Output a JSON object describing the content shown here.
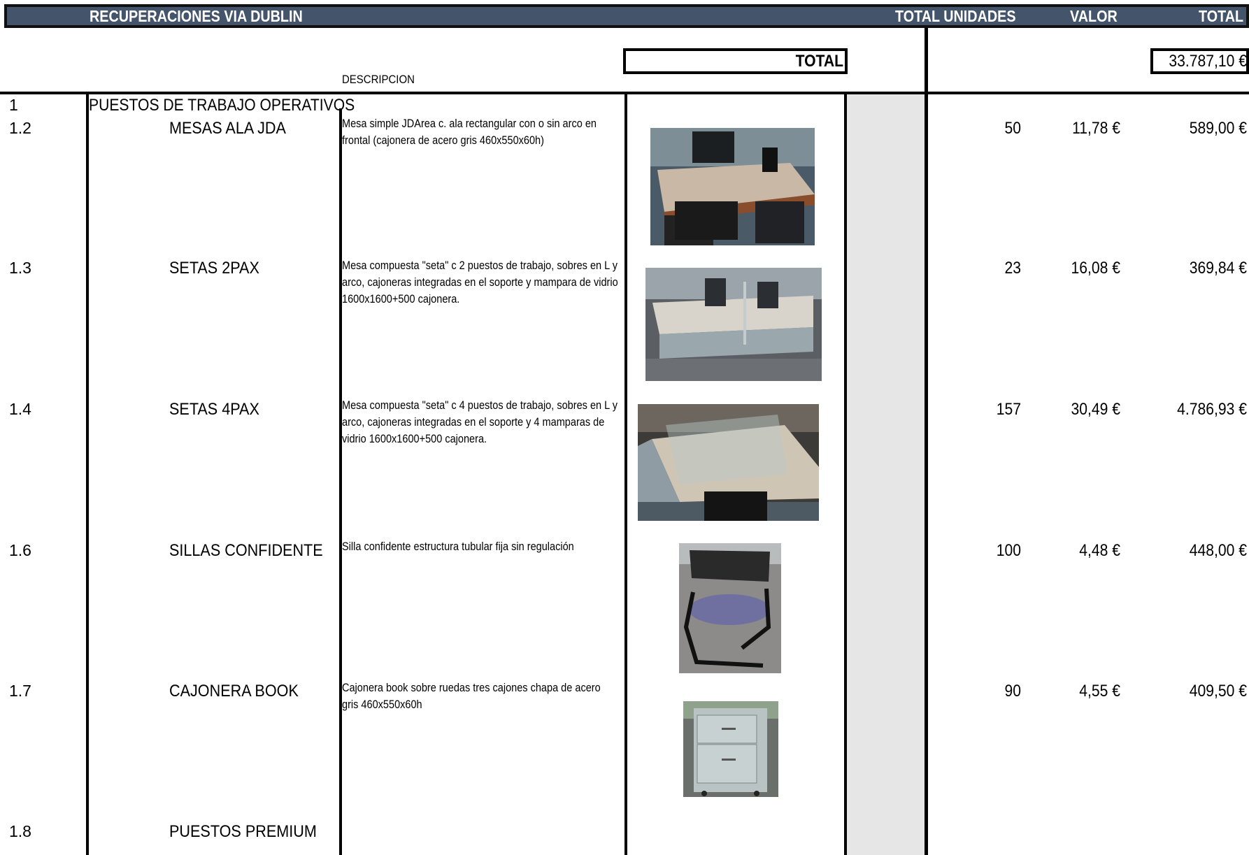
{
  "header": {
    "title": "RECUPERACIONES VIA DUBLIN",
    "col_units": "TOTAL UNIDADES",
    "col_value": "VALOR",
    "col_total": "TOTAL"
  },
  "summary": {
    "total_label": "TOTAL",
    "total_value": "33.787,10 €",
    "description_header": "DESCRIPCION"
  },
  "section": {
    "code": "1",
    "title": "PUESTOS DE TRABAJO OPERATIVOS"
  },
  "rows": [
    {
      "code": "1.2",
      "name": "MESAS ALA JDA",
      "description": "Mesa simple JDArea c. ala rectangular con o sin arco en frontal (cajonera de acero gris 460x550x60h)",
      "units": "50",
      "value": "11,78 €",
      "total": "589,00 €",
      "photo_icon": "office-desk-photo"
    },
    {
      "code": "1.3",
      "name": "SETAS 2PAX",
      "description": "Mesa compuesta \"seta\" c 2 puestos de trabajo, sobres en L y arco, cajoneras integradas en el soporte y mampara de vidrio 1600x1600+500 cajonera.",
      "units": "23",
      "value": "16,08 €",
      "total": "369,84 €",
      "photo_icon": "workstation-2pax-photo"
    },
    {
      "code": "1.4",
      "name": "SETAS 4PAX",
      "description": "Mesa compuesta \"seta\" c 4 puestos de trabajo, sobres en L y arco, cajoneras integradas en el soporte y 4 mamparas de vidrio 1600x1600+500 cajonera.",
      "units": "157",
      "value": "30,49 €",
      "total": "4.786,93 €",
      "photo_icon": "workstation-4pax-photo"
    },
    {
      "code": "1.6",
      "name": "SILLAS CONFIDENTE",
      "description": "Silla confidente estructura tubular fija sin regulación",
      "units": "100",
      "value": "4,48 €",
      "total": "448,00 €",
      "photo_icon": "chair-photo"
    },
    {
      "code": "1.7",
      "name": "CAJONERA BOOK",
      "description": "Cajonera book sobre ruedas tres cajones chapa de acero gris 460x550x60h",
      "units": "90",
      "value": "4,55 €",
      "total": "409,50 €",
      "photo_icon": "drawer-cabinet-photo"
    },
    {
      "code": "1.8",
      "name": "PUESTOS PREMIUM",
      "description": "",
      "units": "",
      "value": "",
      "total": ""
    }
  ],
  "colors": {
    "header_bg": "#44546a",
    "header_text": "#ffffff",
    "gray_column": "#e6e6e6"
  }
}
